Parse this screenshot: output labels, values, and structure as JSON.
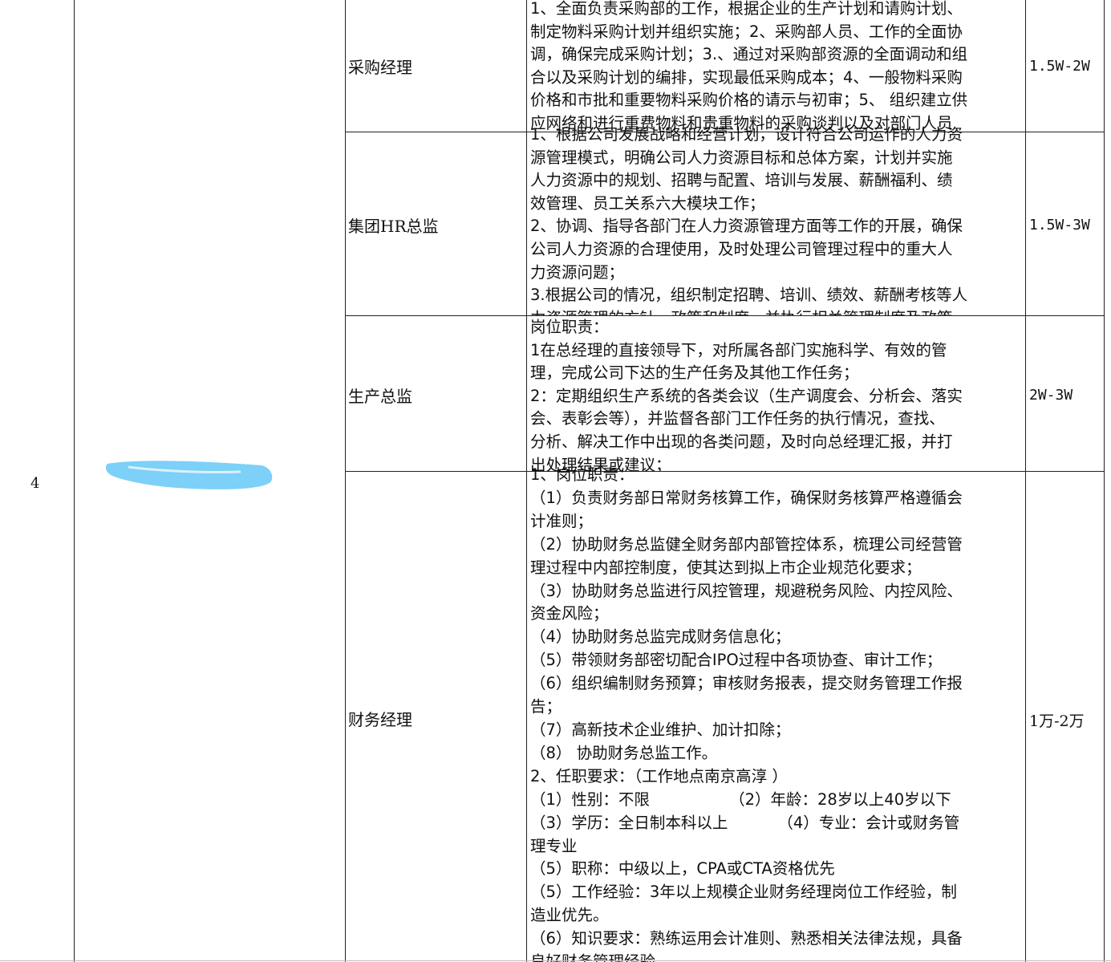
{
  "row_index": "4",
  "rows": [
    {
      "position": "采购经理",
      "salary": "1.5W-2W",
      "duties": [
        "1、全面负责采购部的工作，根据企业的生产计划和请购计划、",
        "制定物料采购计划并组织实施；2、采购部人员、工作的全面协",
        "调，确保完成采购计划；3.、通过对采购部资源的全面调动和组",
        "合以及采购计划的编排，实现最低采购成本；4、一般物料采购",
        "价格和市批和重要物料采购价格的请示与初审；5、 组织建立供",
        "应网络和进行重费物料和贵重物料的采购谈判以及对部门人员"
      ]
    },
    {
      "position": "集团HR总监",
      "salary": "1.5W-3W",
      "duties": [
        "1、根据公司发展战略和经营计划，设计符合公司运作的人力资",
        "源管理模式，明确公司人力资源目标和总体方案，计划并实施",
        "人力资源中的规划、招聘与配置、培训与发展、薪酬福利、绩",
        "效管理、员工关系六大模块工作；",
        "2、协调、指导各部门在人力资源管理方面等工作的开展，确保",
        "公司人力资源的合理使用，及时处理公司管理过程中的重大人",
        "力资源问题；",
        "3.根据公司的情况，组织制定招聘、培训、绩效、薪酬考核等人",
        "力资源管理的方针、政策和制度，并执行相关管理制度及政策"
      ]
    },
    {
      "position": "生产总监",
      "salary": "2W-3W",
      "duties": [
        "岗位职责：",
        "1在总经理的直接领导下，对所属各部门实施科学、有效的管",
        "理，完成公司下达的生产任务及其他工作任务；",
        "2：定期组织生产系统的各类会议（生产调度会、分析会、落实",
        "会、表彰会等），并监督各部门工作任务的执行情况，查找、",
        "分析、解决工作中出现的各类问题，及时向总经理汇报，并打",
        "出处理结果或建议；"
      ]
    },
    {
      "position": "财务经理",
      "salary": "1万-2万",
      "duties": [
        "1、岗位职责：",
        "（1）负责财务部日常财务核算工作，确保财务核算严格遵循会",
        "计准则；",
        "（2）协助财务总监健全财务部内部管控体系，梳理公司经营管",
        "理过程中内部控制度，使其达到拟上市企业规范化要求；",
        "（3）协助财务总监进行风控管理，规避税务风险、内控风险、",
        "资金风险；",
        "（4）协助财务总监完成财务信息化；",
        "（5）带领财务部密切配合IPO过程中各项协查、审计工作；",
        "（6）组织编制财务预算；审核财务报表，提交财务管理工作报",
        "告；",
        "（7）高新技术企业维护、加计扣除；",
        "（8） 协助财务总监工作。",
        "2、任职要求：（工作地点南京高淳 ）",
        "（1）性别：不限                （2）年龄：28岁以上40岁以下",
        "（3）学历：全日制本科以上          （4）专业：会计或财务管",
        "理专业",
        "（5）职称：中级以上，CPA或CTA资格优先",
        "（5）工作经验：3年以上规模企业财务经理岗位工作经验，制",
        "造业优先。",
        "（6）知识要求：熟练运用会计准则、熟悉相关法律法规，具备",
        "良好财务管理经验"
      ]
    }
  ]
}
